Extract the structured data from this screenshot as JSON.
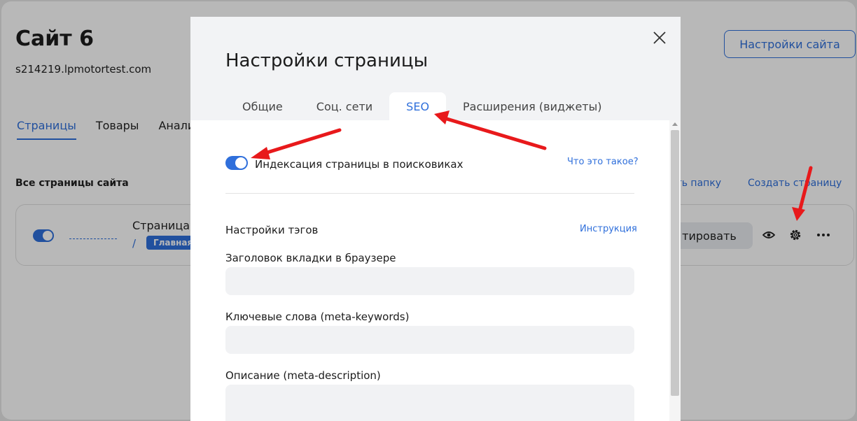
{
  "site": {
    "title": "Сайт 6",
    "domain": "s214219.lpmotortest.com",
    "settings_button": "Настройки сайта"
  },
  "nav": {
    "tabs": [
      {
        "label": "Страницы"
      },
      {
        "label": "Товары"
      },
      {
        "label": "Аналит"
      }
    ]
  },
  "pages_section": {
    "heading": "Все страницы сайта",
    "folder_link": "ать папку",
    "create_link": "Создать страницу"
  },
  "page_card": {
    "name": "Страница",
    "slash": "/",
    "badge": "Главная",
    "edit_label": "тировать",
    "icons": [
      "eye-icon",
      "gear-icon",
      "more-icon"
    ]
  },
  "modal": {
    "title": "Настройки страницы",
    "tabs": [
      {
        "label": "Общие"
      },
      {
        "label": "Соц. сети"
      },
      {
        "label": "SEO"
      },
      {
        "label": "Расширения (виджеты)"
      }
    ],
    "active_tab": "SEO",
    "indexing_label": "Индексация страницы в поисковиках",
    "indexing_enabled": true,
    "what_is_it_link": "Что это такое?",
    "tags_heading": "Настройки тэгов",
    "instruction_link": "Инструкция",
    "fields": {
      "browser_title": {
        "label": "Заголовок вкладки в браузере",
        "value": ""
      },
      "keywords": {
        "label": "Ключевые слова (meta-keywords)",
        "value": ""
      },
      "description": {
        "label": "Описание (meta-description)",
        "value": ""
      }
    }
  },
  "colors": {
    "accent": "#2f6fdb",
    "annotation_arrow": "#e8191b"
  }
}
